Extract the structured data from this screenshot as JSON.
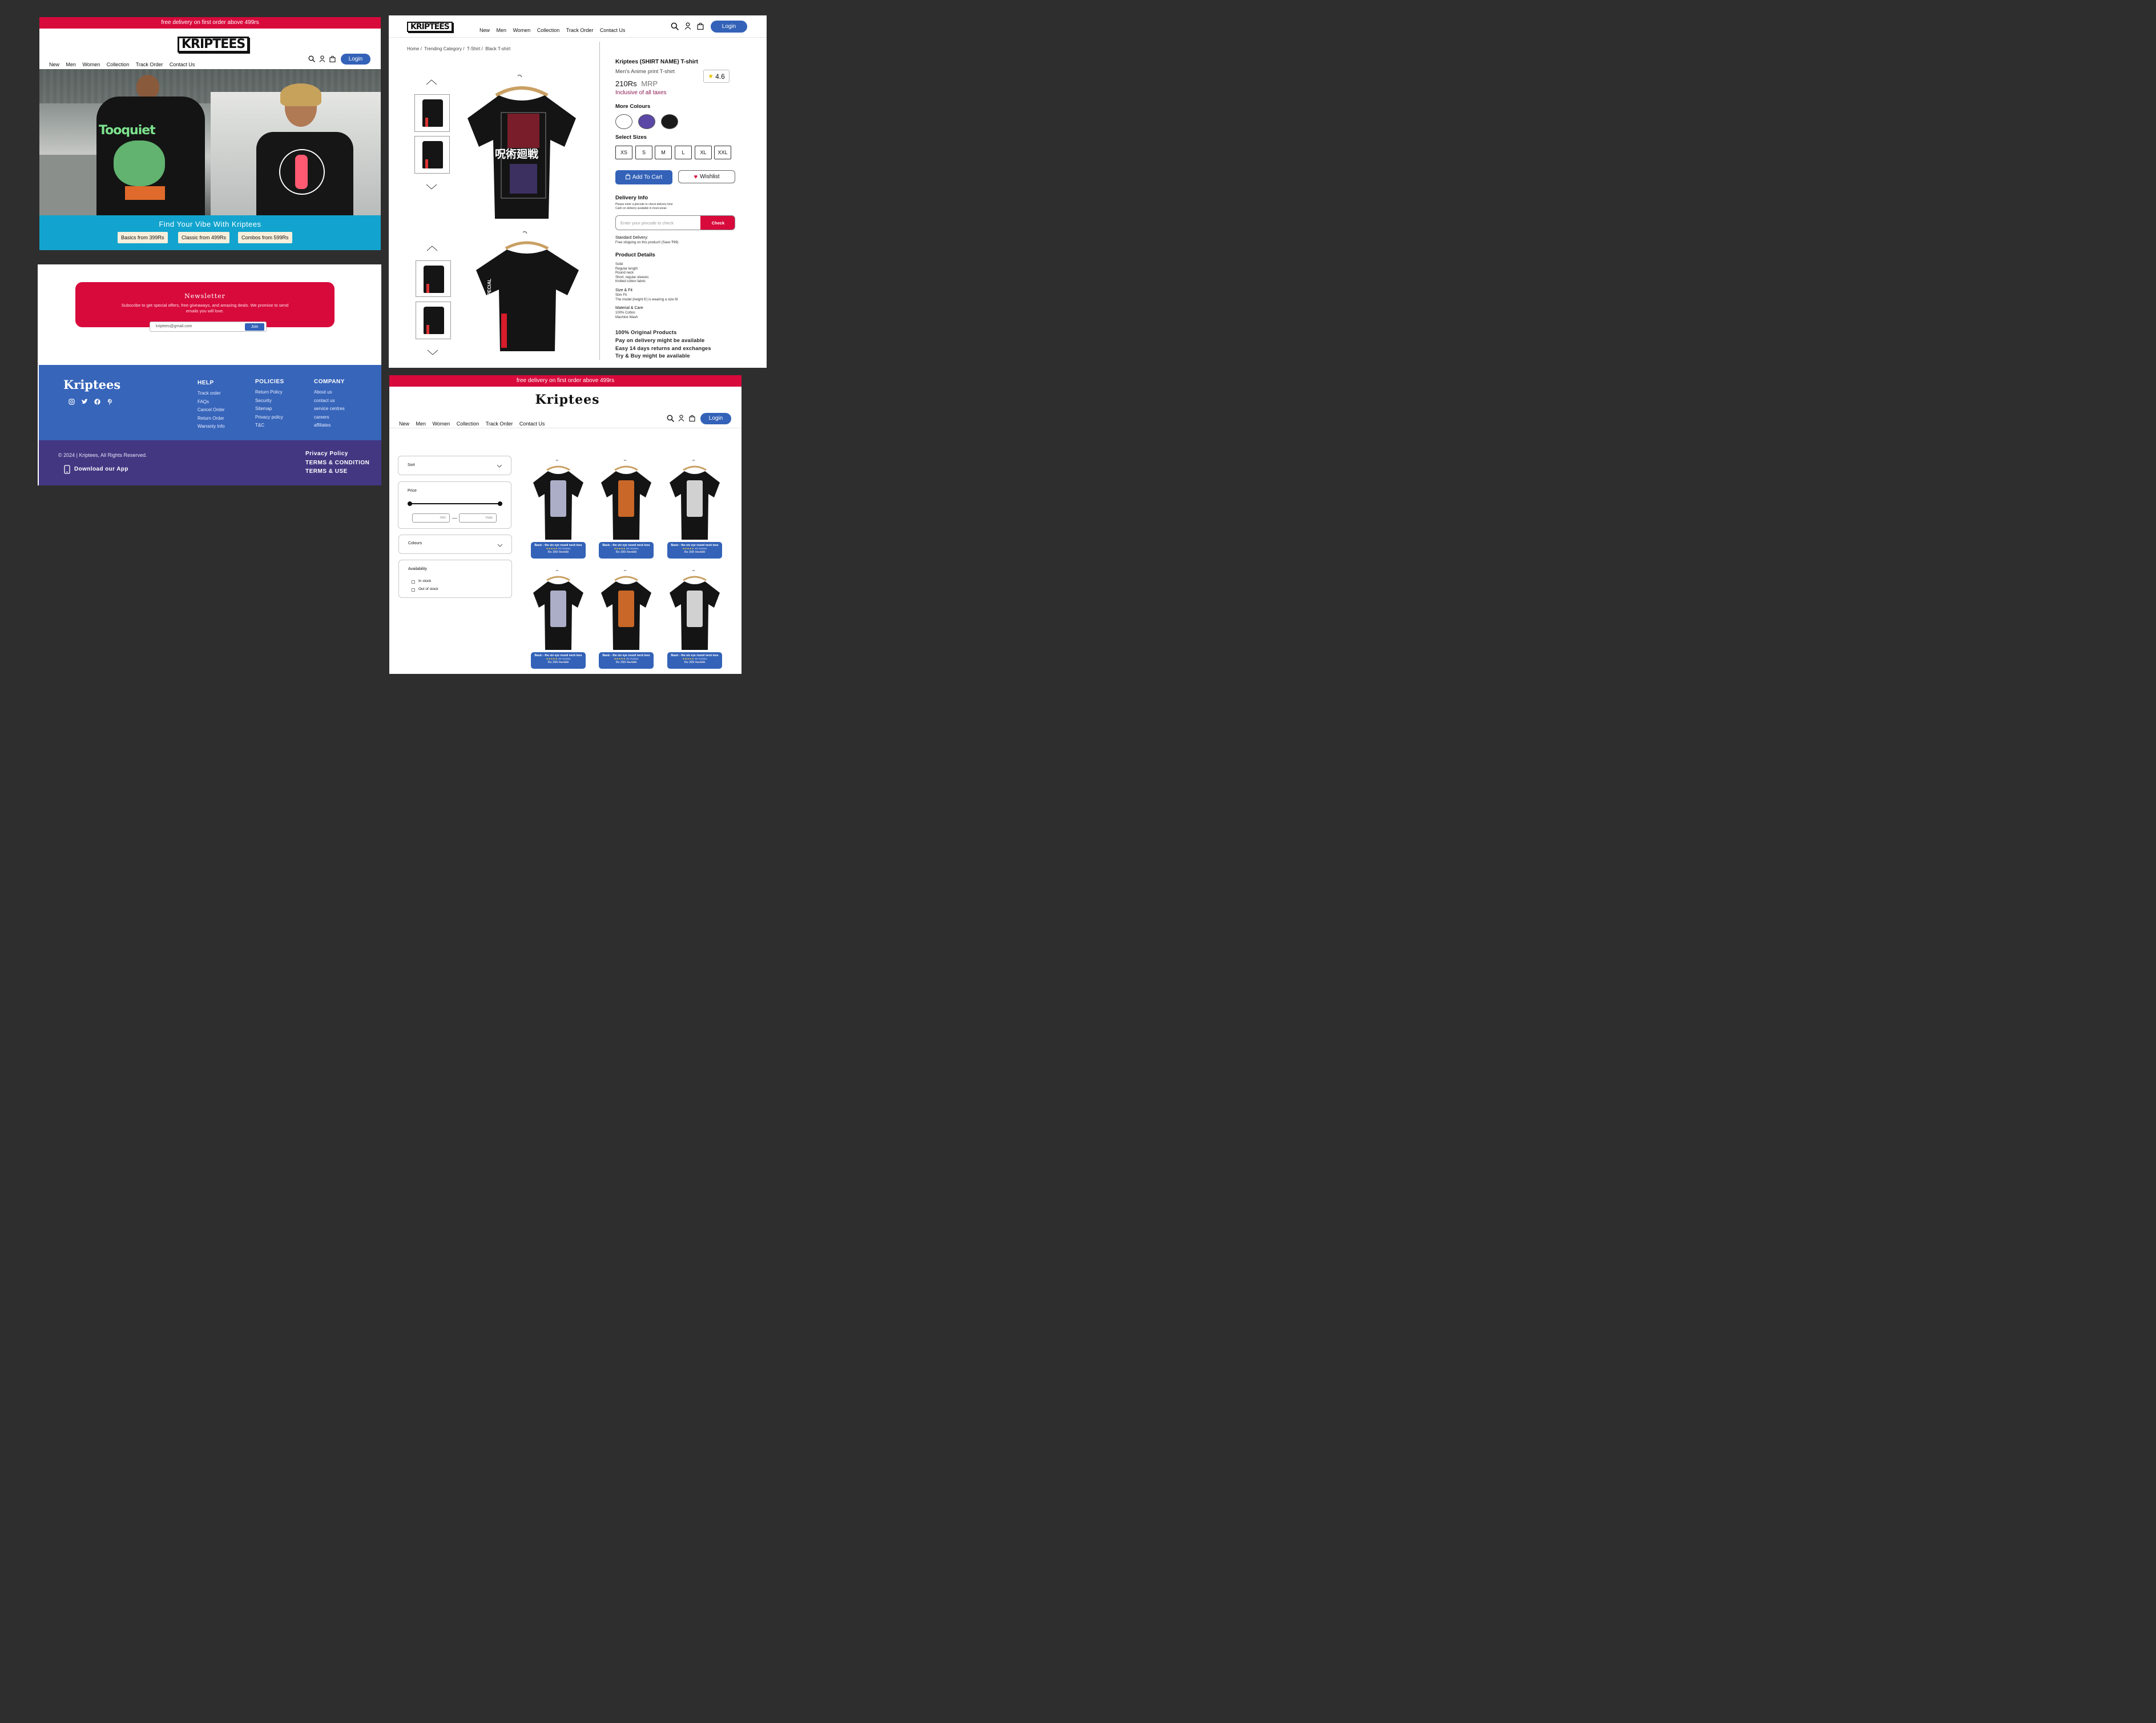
{
  "home": {
    "promo": "free delivery on first order above 499rs",
    "logo": "KRIPTEES",
    "nav": [
      "New",
      "Men",
      "Women",
      "Collection",
      "Track Order",
      "Contact Us"
    ],
    "login": "Login",
    "hero": {
      "back_print": "Tooquiet",
      "headline": "Find Your Vibe With Kriptees",
      "chips": [
        "Basics from 399Rs",
        "Classic from 499Rs",
        "Combos from 599Rs"
      ]
    }
  },
  "newsletter": {
    "title": "Newsletter",
    "text": "Subscribe to get special offers, free giveaways, and amazing deals. We promise to send emails you will love.",
    "email_value": "kriptees@gmail.com",
    "join": "Join"
  },
  "footer": {
    "brand": "Kriptees",
    "social_icons": [
      "instagram-icon",
      "twitter-icon",
      "facebook-icon",
      "pinterest-icon"
    ],
    "help": {
      "title": "HELP",
      "items": [
        "Track order",
        "FAQs",
        "Cancel Order",
        "Return Order",
        "Warranty Info"
      ]
    },
    "policies": {
      "title": "POLICIES",
      "items": [
        "Return Policy",
        "Security",
        "Sitemap",
        "Privacy policy",
        "T&C"
      ]
    },
    "company": {
      "title": "COMPANY",
      "items": [
        "About us",
        "contact us",
        "service centres",
        "careers",
        "affiliates"
      ]
    },
    "copyright": "© 2024 | Kriptees, All Rights Reserved.",
    "download": "Download our App",
    "legal": [
      "Privacy Policy",
      "TERMS & CONDITION",
      "TERMS & USE"
    ]
  },
  "product": {
    "logo": "KRIPTEES",
    "nav": [
      "New",
      "Men",
      "Women",
      "Collection",
      "Track Order",
      "Contact Us"
    ],
    "login": "Login",
    "breadcrumb": [
      "Home /",
      "Trending Category /",
      "T-Shirt /",
      "Black T-shirt"
    ],
    "shirt_print_text": "呪術廻戦",
    "shirt_back_text": "YOU ARE MY SPECIAL",
    "name": "Kriptees (SHIRT NAME) T-shirt",
    "subtitle": "Men's Anime print T-shirt",
    "rating": "4.6",
    "price": "210Rs",
    "mrp": "MRP",
    "tax": "Inclusive of all taxes",
    "more_colours": "More Colours",
    "colours": [
      "#ffffff",
      "#5b47a6",
      "#1a1a1a"
    ],
    "select_sizes": "Select Sizes",
    "sizes": [
      "XS",
      "S",
      "M",
      "L",
      "XL",
      "XXL"
    ],
    "add_to_cart": "Add To Cart",
    "wishlist": "Wishlist",
    "delivery_title": "Delivery Info",
    "delivery_note1": "Please enter a pincode to check delivery time",
    "delivery_note2": "Cash on delivery available in most areas",
    "pincode_placeholder": "Enter your pincode to check",
    "check": "Check",
    "std_delivery": "Standard Delivery:",
    "std_delivery_note": "Free shipping on this product! (Save ₹99)",
    "details_title": "Product Details",
    "details": [
      "Solid",
      "Regular length",
      "Round neck",
      "Short, regular sleeves",
      "Knitted cotton fabric"
    ],
    "size_fit_title": "Size & Fit",
    "size_fit": [
      "Slim Fit",
      "The model (height 6') is wearing a size M"
    ],
    "material_title": "Material & Care",
    "material": [
      "100% Cotton",
      "Machine Wash"
    ],
    "assurances": [
      "100% Original Products",
      "Pay on delivery might be available",
      "Easy 14 days returns and exchanges",
      "Try & Buy might be available"
    ]
  },
  "listing": {
    "promo": "free delivery on first order above 499rs",
    "logo": "Kriptees",
    "nav": [
      "New",
      "Men",
      "Women",
      "Collection",
      "Track Order",
      "Contact Us"
    ],
    "login": "Login",
    "filters": {
      "sort": "Sort",
      "price": "Price",
      "min": "min",
      "max": "max",
      "colours": "Colours",
      "availability": "Availability",
      "in_stock": "In stock",
      "out_of_stock": "Out of stock"
    },
    "products": [
      {
        "title": "Basic - the six eye round neck tees",
        "stars": "★★★★★",
        "reviews": "20 reviews",
        "price": "Rs 399",
        "old": "Rs 699"
      },
      {
        "title": "Basic - the six eye round neck tees",
        "stars": "★★★★★",
        "reviews": "20 reviews",
        "price": "Rs 399",
        "old": "Rs 699"
      },
      {
        "title": "Basic - the six eye round neck tees",
        "stars": "★★★★★",
        "reviews": "20 reviews",
        "price": "Rs 399",
        "old": "Rs 699"
      },
      {
        "title": "Basic - the six eye round neck tees",
        "stars": "★★★★★",
        "reviews": "20 reviews",
        "price": "Rs 399",
        "old": "Rs 699"
      },
      {
        "title": "Basic - the six eye round neck tees",
        "stars": "★★★★★",
        "reviews": "20 reviews",
        "price": "Rs 399",
        "old": "Rs 699"
      },
      {
        "title": "Basic - the six eye round neck tees",
        "stars": "★★★★★",
        "reviews": "20 reviews",
        "price": "Rs 399",
        "old": "Rs 699"
      }
    ]
  },
  "colors": {
    "accent_red": "#d80a3c",
    "brand_blue": "#3362b8",
    "footer_purple": "#433782",
    "hero_cyan": "#12a4cf"
  }
}
